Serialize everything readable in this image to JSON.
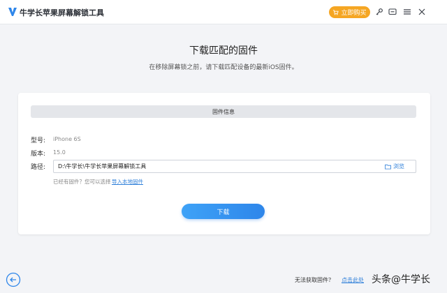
{
  "app": {
    "title": "牛学长苹果屏幕解锁工具",
    "buy_label": "立即购买"
  },
  "header": {
    "title": "下载匹配的固件",
    "subtitle": "在移除屏幕锁之前，请下载匹配设备的最新iOS固件。"
  },
  "firmware": {
    "section_title": "固件信息",
    "model_label": "型号:",
    "model_value": "iPhone 6S",
    "version_label": "版本:",
    "version_value": "15.0",
    "path_label": "路径:",
    "path_value": "D:\\牛学长\\牛学长苹果屏幕解锁工具",
    "browse_label": "浏览",
    "hint_text": "已经有固件？您可以选择",
    "hint_link": "导入本地固件",
    "download_label": "下载"
  },
  "footer": {
    "question": "无法获取固件？",
    "link": "点击此处"
  },
  "watermark": "头条@牛学长",
  "colors": {
    "accent": "#2e86ea",
    "buy": "#f5a623"
  },
  "icons": [
    "logo-icon",
    "cart-icon",
    "key-icon",
    "feedback-icon",
    "menu-icon",
    "close-icon",
    "folder-icon",
    "back-arrow-icon"
  ]
}
